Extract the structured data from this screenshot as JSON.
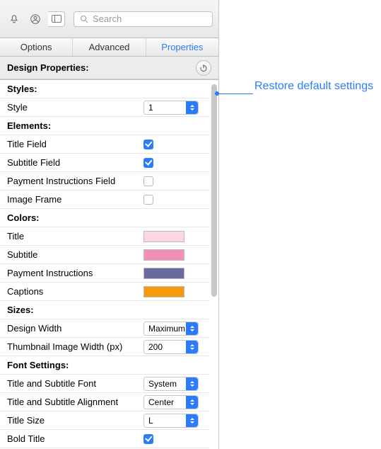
{
  "toolbar": {
    "search_placeholder": "Search"
  },
  "tabs": [
    "Options",
    "Advanced",
    "Properties"
  ],
  "active_tab": 2,
  "section_title": "Design Properties:",
  "callout": "Restore default settings",
  "groups": {
    "styles": {
      "title": "Styles:",
      "style_label": "Style",
      "style_value": "1"
    },
    "elements": {
      "title": "Elements:",
      "items": [
        {
          "label": "Title Field",
          "checked": true
        },
        {
          "label": "Subtitle Field",
          "checked": true
        },
        {
          "label": "Payment Instructions Field",
          "checked": false
        },
        {
          "label": "Image Frame",
          "checked": false
        }
      ]
    },
    "colors": {
      "title": "Colors:",
      "items": [
        {
          "label": "Title",
          "hex": "#fcd7df"
        },
        {
          "label": "Subtitle",
          "hex": "#f18fb7"
        },
        {
          "label": "Payment Instructions",
          "hex": "#6a6aa0"
        },
        {
          "label": "Captions",
          "hex": "#f59a0b"
        }
      ]
    },
    "sizes": {
      "title": "Sizes:",
      "design_width_label": "Design Width",
      "design_width_value": "Maximum",
      "thumb_width_label": "Thumbnail Image Width (px)",
      "thumb_width_value": "200"
    },
    "fonts": {
      "title": "Font Settings:",
      "font_label": "Title and Subtitle Font",
      "font_value": "System",
      "align_label": "Title and Subtitle Alignment",
      "align_value": "Center",
      "size_label": "Title Size",
      "size_value": "L",
      "bold_label": "Bold Title",
      "bold_checked": true
    }
  }
}
